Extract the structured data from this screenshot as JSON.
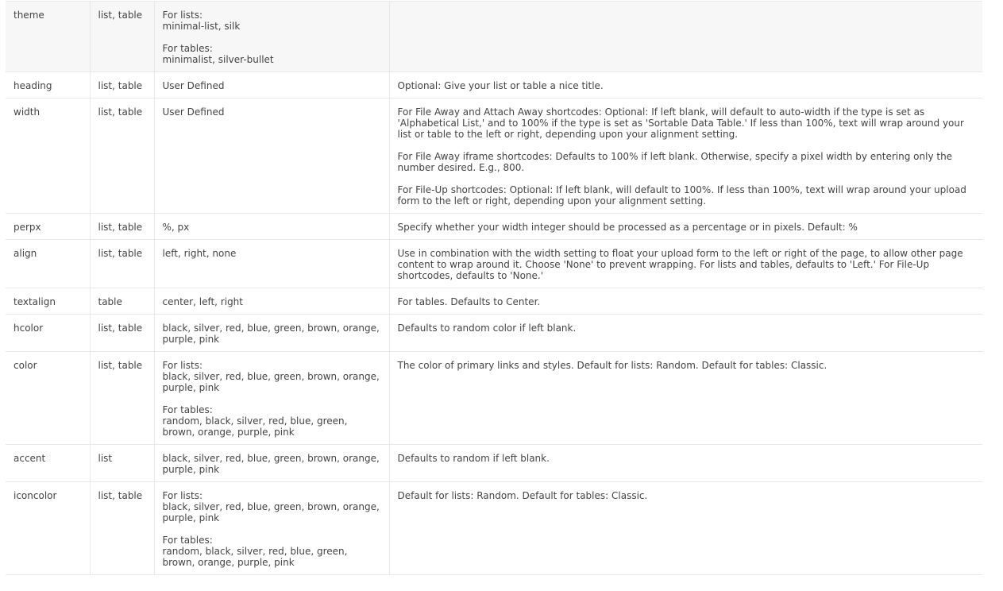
{
  "rows": [
    {
      "attr": "theme",
      "scope": "list, table",
      "options": [
        "For lists:\nminimal-list, silk",
        "For tables:\nminimalist, silver-bullet"
      ],
      "desc": []
    },
    {
      "attr": "heading",
      "scope": "list, table",
      "options": [
        "User Defined"
      ],
      "desc": [
        "Optional: Give your list or table a nice title."
      ]
    },
    {
      "attr": "width",
      "scope": "list, table",
      "options": [
        "User Defined"
      ],
      "desc": [
        "For File Away and Attach Away shortcodes: Optional: If left blank, will default to auto-width if the type is set as 'Alphabetical List,' and to 100% if the type is set as 'Sortable Data Table.' If less than 100%, text will wrap around your list or table to the left or right, depending upon your alignment setting.",
        "For File Away iframe shortcodes: Defaults to 100% if left blank. Otherwise, specify a pixel width by entering only the number desired. E.g., 800.",
        "For File-Up shortcodes: Optional: If left blank, will default to 100%. If less than 100%, text will wrap around your upload form to the left or right, depending upon your alignment setting."
      ]
    },
    {
      "attr": "perpx",
      "scope": "list, table",
      "options": [
        "%, px"
      ],
      "desc": [
        "Specify whether your width integer should be processed as a percentage or in pixels. Default: %"
      ]
    },
    {
      "attr": "align",
      "scope": "list, table",
      "options": [
        "left, right, none"
      ],
      "desc": [
        "Use in combination with the width setting to float your upload form to the left or right of the page, to allow other page content to wrap around it. Choose 'None' to prevent wrapping. For lists and tables, defaults to 'Left.' For File-Up shortcodes, defaults to 'None.'"
      ]
    },
    {
      "attr": "textalign",
      "scope": "table",
      "options": [
        "center, left, right"
      ],
      "desc": [
        "For tables. Defaults to Center."
      ]
    },
    {
      "attr": "hcolor",
      "scope": "list, table",
      "options": [
        "black, silver, red, blue, green, brown, orange, purple, pink"
      ],
      "desc": [
        "Defaults to random color if left blank."
      ]
    },
    {
      "attr": "color",
      "scope": "list, table",
      "options": [
        "For lists:\nblack, silver, red, blue, green, brown, orange, purple, pink",
        "For tables:\nrandom, black, silver, red, blue, green, brown, orange, purple, pink"
      ],
      "desc": [
        "The color of primary links and styles. Default for lists: Random. Default for tables: Classic."
      ]
    },
    {
      "attr": "accent",
      "scope": "list",
      "options": [
        "black, silver, red, blue, green, brown, orange, purple, pink"
      ],
      "desc": [
        "Defaults to random if left blank."
      ]
    },
    {
      "attr": "iconcolor",
      "scope": "list, table",
      "options": [
        "For lists:\nblack, silver, red, blue, green, brown, orange, purple, pink",
        "For tables:\nrandom, black, silver, red, blue, green, brown, orange, purple, pink"
      ],
      "desc": [
        "Default for lists: Random. Default for tables: Classic."
      ]
    }
  ]
}
